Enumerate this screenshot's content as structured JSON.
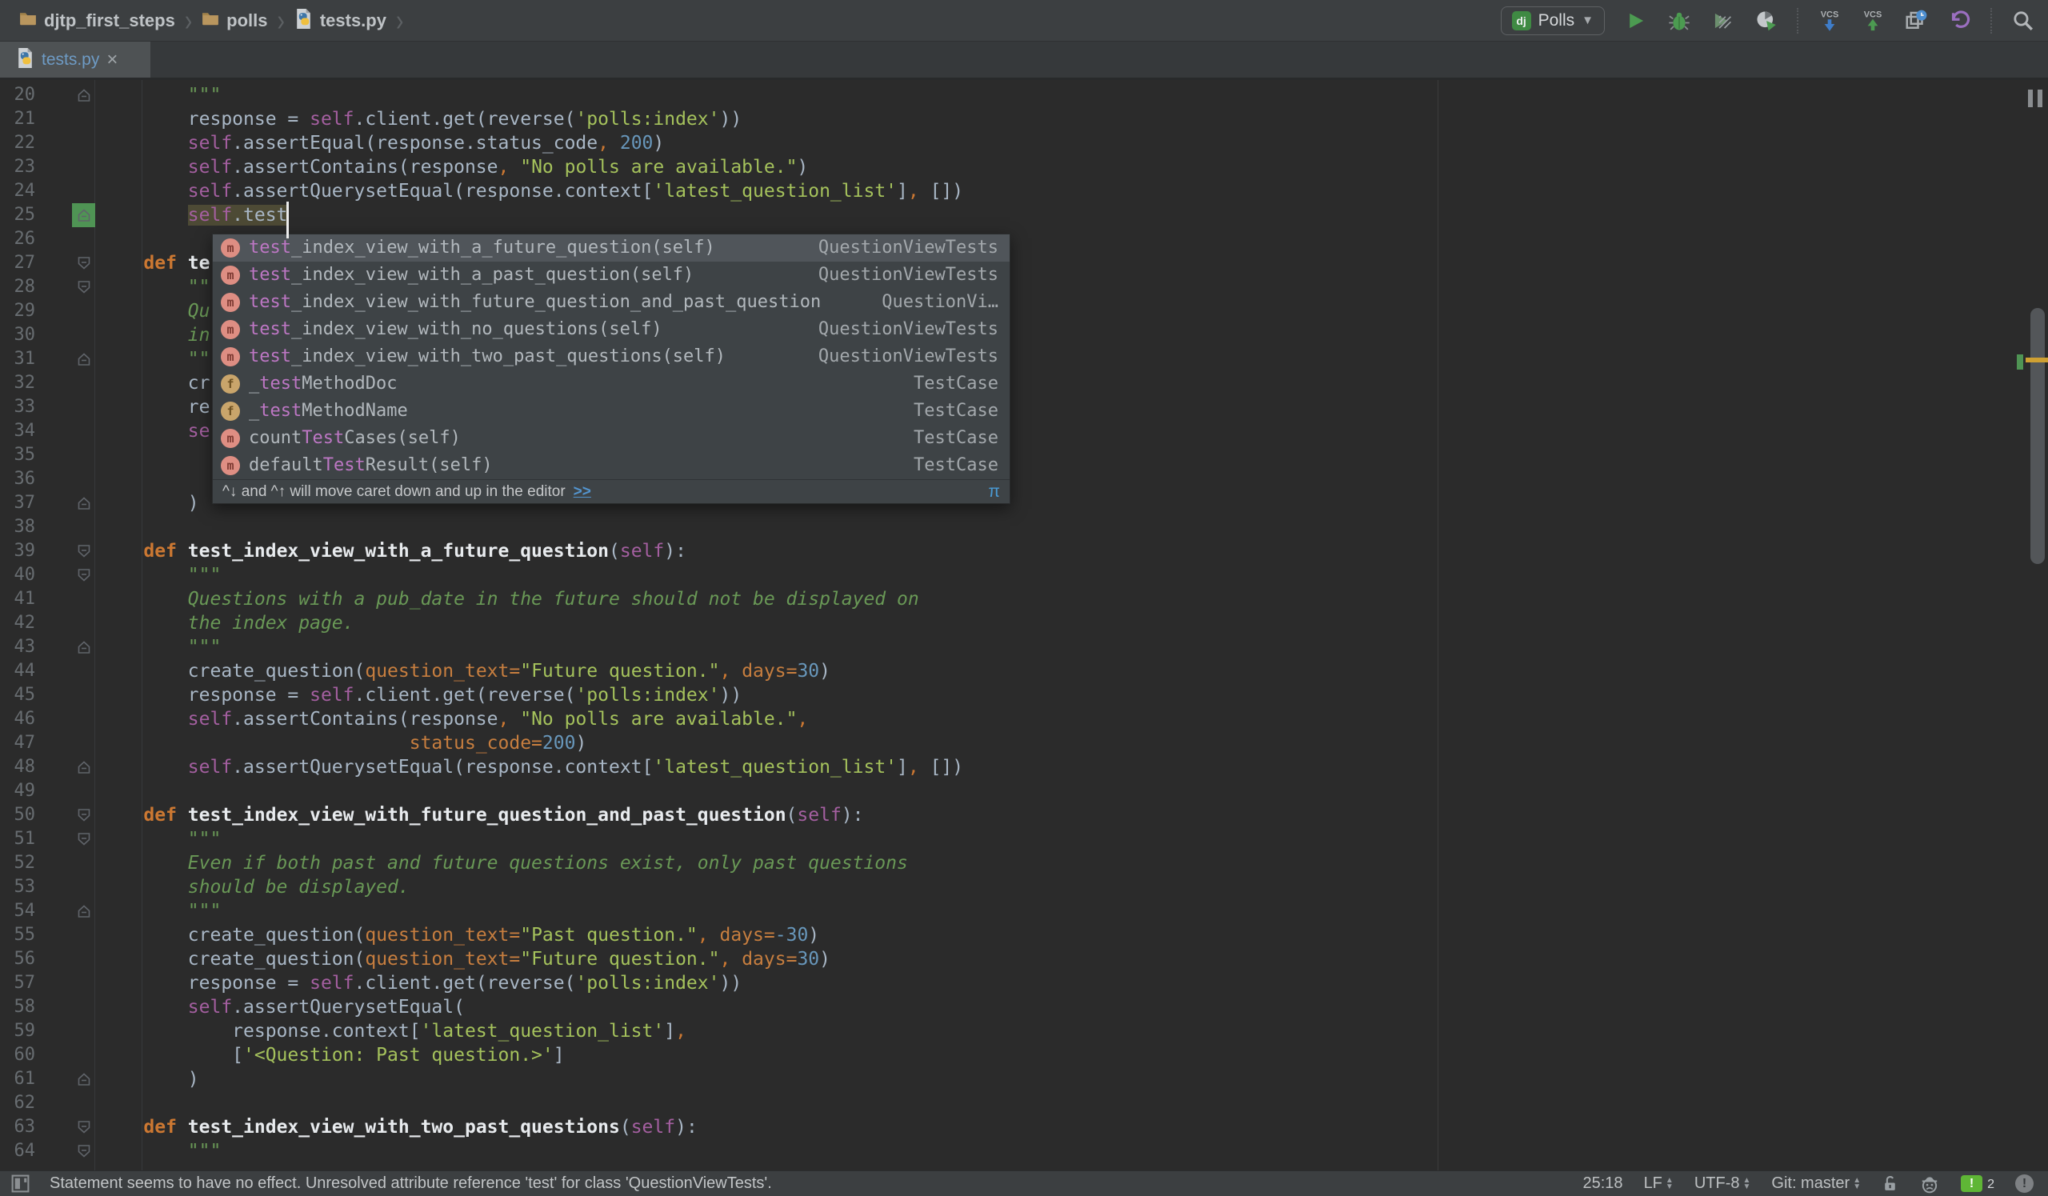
{
  "breadcrumbs": {
    "items": [
      {
        "label": "djtp_first_steps",
        "icon": "folder-icon"
      },
      {
        "label": "polls",
        "icon": "folder-icon"
      },
      {
        "label": "tests.py",
        "icon": "python-file-icon"
      }
    ]
  },
  "toolbar": {
    "dj_badge": "dj",
    "run_config": "Polls",
    "icons": [
      "run-icon",
      "debug-icon",
      "run-with-coverage-icon",
      "profiler-icon",
      "vcs-update-icon",
      "vcs-commit-icon",
      "recent-changes-icon",
      "rollback-icon",
      "search-icon"
    ],
    "vcs_label": "VCS"
  },
  "tab": {
    "label": "tests.py",
    "close": "×"
  },
  "editor": {
    "lines": [
      {
        "n": 20,
        "fold": "up",
        "segs": [
          [
            "q",
            "        \"\"\""
          ]
        ]
      },
      {
        "n": 21,
        "segs": [
          [
            "p",
            "        response = "
          ],
          [
            "s",
            "self"
          ],
          [
            "p",
            ".client.get(reverse("
          ],
          [
            "t",
            "'polls:index'"
          ],
          [
            "p",
            "))"
          ]
        ]
      },
      {
        "n": 22,
        "segs": [
          [
            "p",
            "        "
          ],
          [
            "s",
            "self"
          ],
          [
            "p",
            ".assertEqual(response.status_code"
          ],
          [
            "c",
            ","
          ],
          [
            "p",
            " "
          ],
          [
            "n",
            "200"
          ],
          [
            "p",
            ")"
          ]
        ]
      },
      {
        "n": 23,
        "segs": [
          [
            "p",
            "        "
          ],
          [
            "s",
            "self"
          ],
          [
            "p",
            ".assertContains(response"
          ],
          [
            "c",
            ","
          ],
          [
            "p",
            " "
          ],
          [
            "t",
            "\"No polls are available.\""
          ],
          [
            "p",
            ")"
          ]
        ]
      },
      {
        "n": 24,
        "segs": [
          [
            "p",
            "        "
          ],
          [
            "s",
            "self"
          ],
          [
            "p",
            ".assertQuerysetEqual(response.context["
          ],
          [
            "t",
            "'latest_question_list'"
          ],
          [
            "p",
            "]"
          ],
          [
            "c",
            ","
          ],
          [
            "p",
            " [])"
          ]
        ]
      },
      {
        "n": 25,
        "fold": "up",
        "green": true,
        "segs": [
          [
            "p",
            "        "
          ],
          [
            "s hl",
            "self"
          ],
          [
            "p hl",
            ".test"
          ]
        ]
      },
      {
        "n": 26,
        "segs": []
      },
      {
        "n": 27,
        "fold": "down",
        "segs": [
          [
            "k",
            "    def"
          ],
          [
            "p",
            " "
          ],
          [
            "f",
            "te"
          ]
        ]
      },
      {
        "n": 28,
        "fold": "down",
        "segs": [
          [
            "q",
            "        \"\"\""
          ]
        ]
      },
      {
        "n": 29,
        "segs": [
          [
            "d",
            "        Qu"
          ]
        ]
      },
      {
        "n": 30,
        "segs": [
          [
            "d",
            "        in"
          ]
        ]
      },
      {
        "n": 31,
        "fold": "up",
        "segs": [
          [
            "q",
            "        \"\"\""
          ]
        ]
      },
      {
        "n": 32,
        "segs": [
          [
            "p",
            "        cr"
          ]
        ]
      },
      {
        "n": 33,
        "segs": [
          [
            "p",
            "        re"
          ]
        ]
      },
      {
        "n": 34,
        "segs": [
          [
            "p",
            "        "
          ],
          [
            "s",
            "se"
          ]
        ]
      },
      {
        "n": 35,
        "segs": []
      },
      {
        "n": 36,
        "segs": []
      },
      {
        "n": 37,
        "fold": "up",
        "segs": [
          [
            "p",
            "        )"
          ]
        ]
      },
      {
        "n": 38,
        "segs": []
      },
      {
        "n": 39,
        "fold": "down",
        "segs": [
          [
            "k",
            "    def"
          ],
          [
            "p",
            " "
          ],
          [
            "f",
            "test_index_view_with_a_future_question"
          ],
          [
            "p",
            "("
          ],
          [
            "s",
            "self"
          ],
          [
            "p",
            "):"
          ]
        ]
      },
      {
        "n": 40,
        "fold": "down",
        "segs": [
          [
            "q",
            "        \"\"\""
          ]
        ]
      },
      {
        "n": 41,
        "segs": [
          [
            "d",
            "        Questions with a pub_date in the future should not be displayed on"
          ]
        ]
      },
      {
        "n": 42,
        "segs": [
          [
            "d",
            "        the index page."
          ]
        ]
      },
      {
        "n": 43,
        "fold": "up",
        "segs": [
          [
            "q",
            "        \"\"\""
          ]
        ]
      },
      {
        "n": 44,
        "segs": [
          [
            "p",
            "        create_question("
          ],
          [
            "a",
            "question_text="
          ],
          [
            "t",
            "\"Future question.\""
          ],
          [
            "c",
            ","
          ],
          [
            "p",
            " "
          ],
          [
            "a",
            "days="
          ],
          [
            "n",
            "30"
          ],
          [
            "p",
            ")"
          ]
        ]
      },
      {
        "n": 45,
        "segs": [
          [
            "p",
            "        response = "
          ],
          [
            "s",
            "self"
          ],
          [
            "p",
            ".client.get(reverse("
          ],
          [
            "t",
            "'polls:index'"
          ],
          [
            "p",
            "))"
          ]
        ]
      },
      {
        "n": 46,
        "segs": [
          [
            "p",
            "        "
          ],
          [
            "s",
            "self"
          ],
          [
            "p",
            ".assertContains(response"
          ],
          [
            "c",
            ","
          ],
          [
            "p",
            " "
          ],
          [
            "t",
            "\"No polls are available.\""
          ],
          [
            "c",
            ","
          ]
        ]
      },
      {
        "n": 47,
        "segs": [
          [
            "p",
            "                            "
          ],
          [
            "a",
            "status_code="
          ],
          [
            "n",
            "200"
          ],
          [
            "p",
            ")"
          ]
        ]
      },
      {
        "n": 48,
        "fold": "up",
        "segs": [
          [
            "p",
            "        "
          ],
          [
            "s",
            "self"
          ],
          [
            "p",
            ".assertQuerysetEqual(response.context["
          ],
          [
            "t",
            "'latest_question_list'"
          ],
          [
            "p",
            "]"
          ],
          [
            "c",
            ","
          ],
          [
            "p",
            " [])"
          ]
        ]
      },
      {
        "n": 49,
        "segs": []
      },
      {
        "n": 50,
        "fold": "down",
        "segs": [
          [
            "k",
            "    def"
          ],
          [
            "p",
            " "
          ],
          [
            "f",
            "test_index_view_with_future_question_and_past_question"
          ],
          [
            "p",
            "("
          ],
          [
            "s",
            "self"
          ],
          [
            "p",
            "):"
          ]
        ]
      },
      {
        "n": 51,
        "fold": "down",
        "segs": [
          [
            "q",
            "        \"\"\""
          ]
        ]
      },
      {
        "n": 52,
        "segs": [
          [
            "d",
            "        Even if both past and future questions exist, only past questions"
          ]
        ]
      },
      {
        "n": 53,
        "segs": [
          [
            "d",
            "        should be displayed."
          ]
        ]
      },
      {
        "n": 54,
        "fold": "up",
        "segs": [
          [
            "q",
            "        \"\"\""
          ]
        ]
      },
      {
        "n": 55,
        "segs": [
          [
            "p",
            "        create_question("
          ],
          [
            "a",
            "question_text="
          ],
          [
            "t",
            "\"Past question.\""
          ],
          [
            "c",
            ","
          ],
          [
            "p",
            " "
          ],
          [
            "a",
            "days="
          ],
          [
            "n",
            "-30"
          ],
          [
            "p",
            ")"
          ]
        ]
      },
      {
        "n": 56,
        "segs": [
          [
            "p",
            "        create_question("
          ],
          [
            "a",
            "question_text="
          ],
          [
            "t",
            "\"Future question.\""
          ],
          [
            "c",
            ","
          ],
          [
            "p",
            " "
          ],
          [
            "a",
            "days="
          ],
          [
            "n",
            "30"
          ],
          [
            "p",
            ")"
          ]
        ]
      },
      {
        "n": 57,
        "segs": [
          [
            "p",
            "        response = "
          ],
          [
            "s",
            "self"
          ],
          [
            "p",
            ".client.get(reverse("
          ],
          [
            "t",
            "'polls:index'"
          ],
          [
            "p",
            "))"
          ]
        ]
      },
      {
        "n": 58,
        "segs": [
          [
            "p",
            "        "
          ],
          [
            "s",
            "self"
          ],
          [
            "p",
            ".assertQuerysetEqual("
          ]
        ]
      },
      {
        "n": 59,
        "segs": [
          [
            "p",
            "            response.context["
          ],
          [
            "t",
            "'latest_question_list'"
          ],
          [
            "p",
            "]"
          ],
          [
            "c",
            ","
          ]
        ]
      },
      {
        "n": 60,
        "segs": [
          [
            "p",
            "            ["
          ],
          [
            "t",
            "'<Question: Past question.>'"
          ],
          [
            "p",
            "]"
          ]
        ]
      },
      {
        "n": 61,
        "fold": "up",
        "segs": [
          [
            "p",
            "        )"
          ]
        ]
      },
      {
        "n": 62,
        "segs": []
      },
      {
        "n": 63,
        "fold": "down",
        "segs": [
          [
            "k",
            "    def"
          ],
          [
            "p",
            " "
          ],
          [
            "f",
            "test_index_view_with_two_past_questions"
          ],
          [
            "p",
            "("
          ],
          [
            "s",
            "self"
          ],
          [
            "p",
            "):"
          ]
        ]
      },
      {
        "n": 64,
        "fold": "down",
        "segs": [
          [
            "q",
            "        \"\"\""
          ]
        ]
      }
    ]
  },
  "popup": {
    "items": [
      {
        "kind": "m",
        "pre": "",
        "match": "test",
        "post": "_index_view_with_a_future_question",
        "params": "(self)",
        "tail": "QuestionViewTests",
        "selected": true
      },
      {
        "kind": "m",
        "pre": "",
        "match": "test",
        "post": "_index_view_with_a_past_question",
        "params": "(self)",
        "tail": "QuestionViewTests"
      },
      {
        "kind": "m",
        "pre": "",
        "match": "test",
        "post": "_index_view_with_future_question_and_past_question",
        "params": "",
        "tail": "QuestionVi…"
      },
      {
        "kind": "m",
        "pre": "",
        "match": "test",
        "post": "_index_view_with_no_questions",
        "params": "(self)",
        "tail": "QuestionViewTests"
      },
      {
        "kind": "m",
        "pre": "",
        "match": "test",
        "post": "_index_view_with_two_past_questions",
        "params": "(self)",
        "tail": "QuestionViewTests"
      },
      {
        "kind": "f",
        "pre": "_",
        "match": "test",
        "post": "MethodDoc",
        "params": "",
        "tail": "TestCase"
      },
      {
        "kind": "f",
        "pre": "_",
        "match": "test",
        "post": "MethodName",
        "params": "",
        "tail": "TestCase"
      },
      {
        "kind": "m",
        "pre": "count",
        "match": "Test",
        "post": "Cases",
        "params": "(self)",
        "tail": "TestCase"
      },
      {
        "kind": "m",
        "pre": "default",
        "match": "Test",
        "post": "Result",
        "params": "(self)",
        "tail": "TestCase"
      }
    ],
    "hint": "^↓ and ^↑ will move caret down and up in the editor",
    "hint_link": ">>",
    "pi": "π"
  },
  "status_bar": {
    "message": "Statement seems to have no effect. Unresolved attribute reference 'test' for class 'QuestionViewTests'.",
    "caret_position": "25:18",
    "line_ending": "LF",
    "encoding": "UTF-8",
    "vcs_branch": "Git: master",
    "notification_count": "2",
    "bubble_symbol": "!",
    "inspection_symbol": "!"
  },
  "colors": {
    "editor_bg": "#2B2B2B",
    "ui_bg": "#3C3F41",
    "keyword": "#CC7832",
    "string": "#A5C25C",
    "docstring": "#699856",
    "number": "#6897BB",
    "self": "#A45FA0",
    "param": "#C77E3F",
    "match_highlight": "#BD77C4",
    "modified_tab": "#6E9BC5",
    "vcs_added_green": "#4F9454",
    "caret_stripe_orange": "#CFA032"
  }
}
